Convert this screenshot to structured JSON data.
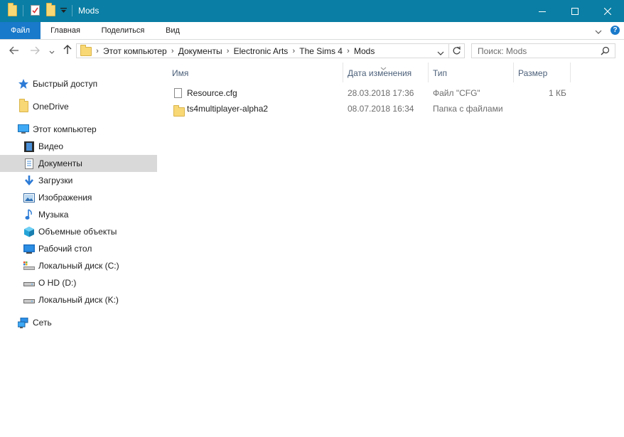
{
  "window": {
    "title": "Mods"
  },
  "ribbon": {
    "tabs": [
      "Файл",
      "Главная",
      "Поделиться",
      "Вид"
    ]
  },
  "address": {
    "crumbs": [
      "Этот компьютер",
      "Документы",
      "Electronic Arts",
      "The Sims 4",
      "Mods"
    ]
  },
  "search": {
    "placeholder": "Поиск: Mods"
  },
  "sidebar": {
    "items": [
      {
        "label": "Быстрый доступ",
        "icon": "star-icon"
      },
      {
        "label": "OneDrive",
        "icon": "folder-icon"
      },
      {
        "label": "Этот компьютер",
        "icon": "computer-icon"
      },
      {
        "label": "Видео",
        "icon": "video-icon"
      },
      {
        "label": "Документы",
        "icon": "document-icon",
        "selected": true
      },
      {
        "label": "Загрузки",
        "icon": "download-icon"
      },
      {
        "label": "Изображения",
        "icon": "pictures-icon"
      },
      {
        "label": "Музыка",
        "icon": "music-icon"
      },
      {
        "label": "Объемные объекты",
        "icon": "3d-objects-icon"
      },
      {
        "label": "Рабочий стол",
        "icon": "desktop-icon"
      },
      {
        "label": "Локальный диск (C:)",
        "icon": "drive-icon"
      },
      {
        "label": "O HD (D:)",
        "icon": "drive-icon"
      },
      {
        "label": "Локальный диск (K:)",
        "icon": "drive-icon"
      },
      {
        "label": "Сеть",
        "icon": "network-icon"
      }
    ]
  },
  "columns": {
    "name": "Имя",
    "date": "Дата изменения",
    "type": "Тип",
    "size": "Размер"
  },
  "files": [
    {
      "name": "Resource.cfg",
      "date": "28.03.2018 17:36",
      "type": "Файл \"CFG\"",
      "size": "1 КБ",
      "icon": "document-icon"
    },
    {
      "name": "ts4multiplayer-alpha2",
      "date": "08.07.2018 16:34",
      "type": "Папка с файлами",
      "size": "",
      "icon": "folder-icon"
    }
  ],
  "colors": {
    "titlebar": "#0a7ea4",
    "file_tab": "#1979ca",
    "selected": "#d9d9d9",
    "header_text": "#4c607a"
  }
}
